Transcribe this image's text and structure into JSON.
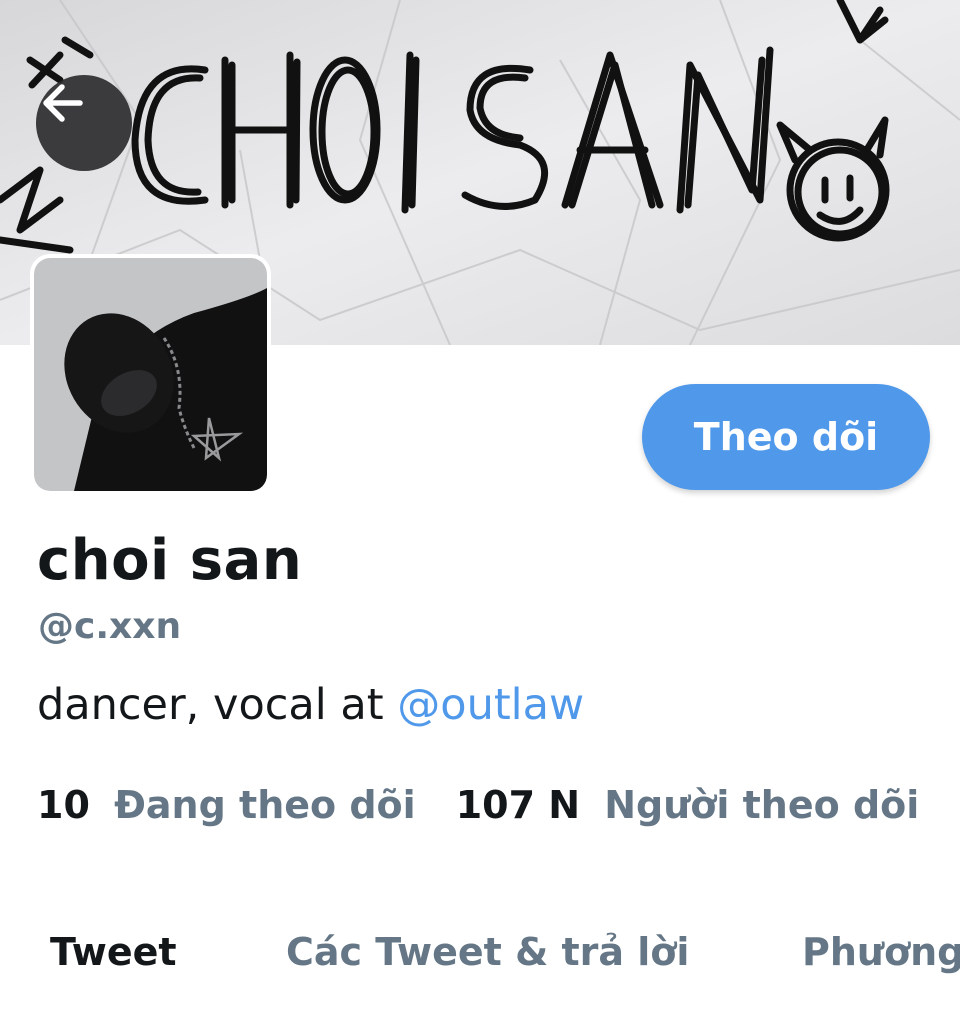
{
  "banner": {
    "text": "CHOI SAN"
  },
  "header": {
    "back_icon": "arrow-left-icon"
  },
  "profile": {
    "display_name": "choi san",
    "handle": "@c.xxn",
    "bio_text": "dancer, vocal at ",
    "bio_mention": "@outlaw",
    "follow_label": "Theo dõi",
    "following_count": "10",
    "following_label": "Đang theo dõi",
    "followers_count": "107 N",
    "followers_label": "Người theo dõi"
  },
  "tabs": [
    {
      "label": "Tweet",
      "active": true
    },
    {
      "label": "Các Tweet & trả lời",
      "active": false
    },
    {
      "label": "Phương",
      "active": false
    }
  ],
  "colors": {
    "accent": "#4f98ea",
    "muted": "#657786",
    "text": "#14171a"
  }
}
